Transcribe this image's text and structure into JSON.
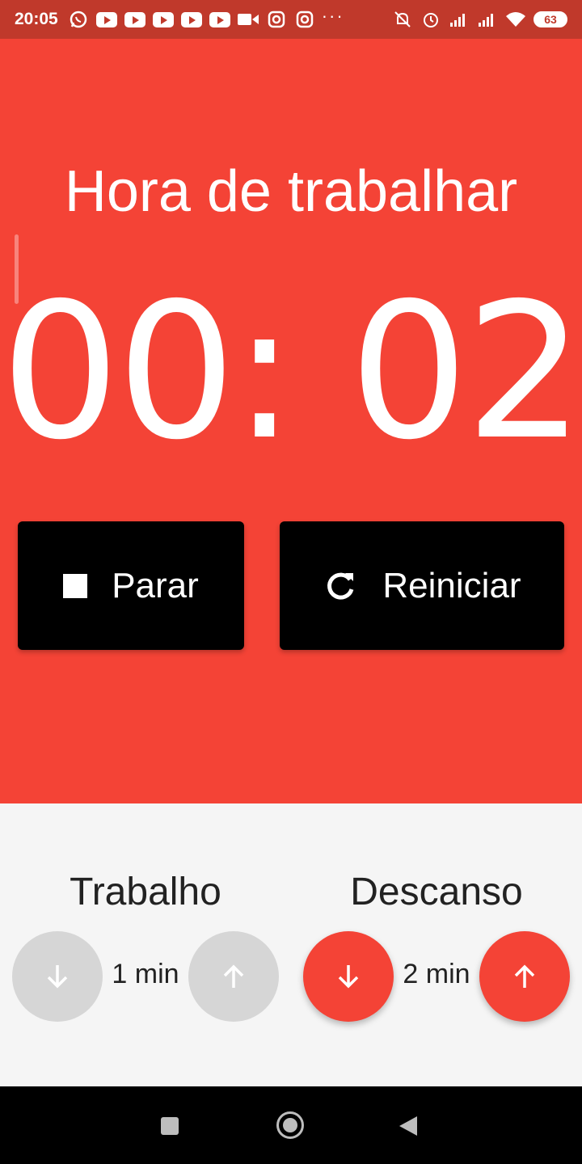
{
  "status_bar": {
    "time": "20:05",
    "battery": "63",
    "icons": [
      "whatsapp-icon",
      "youtube-icon",
      "youtube-icon",
      "youtube-icon",
      "youtube-icon",
      "youtube-icon",
      "video-icon",
      "instagram-icon",
      "instagram-icon",
      "more-icon",
      "mute-icon",
      "alarm-icon",
      "signal-icon",
      "signal-icon",
      "wifi-icon",
      "battery-icon"
    ]
  },
  "header": {
    "title": "Hora de trabalhar"
  },
  "timer": {
    "display": "00: 02"
  },
  "actions": {
    "stop_label": "Parar",
    "restart_label": "Reiniciar"
  },
  "settings": {
    "work": {
      "label": "Trabalho",
      "value": "1 min"
    },
    "rest": {
      "label": "Descanso",
      "value": "2 min"
    }
  },
  "colors": {
    "accent": "#f44336",
    "button": "#000000",
    "panel": "#f5f5f5",
    "disabled": "#d6d6d6"
  }
}
